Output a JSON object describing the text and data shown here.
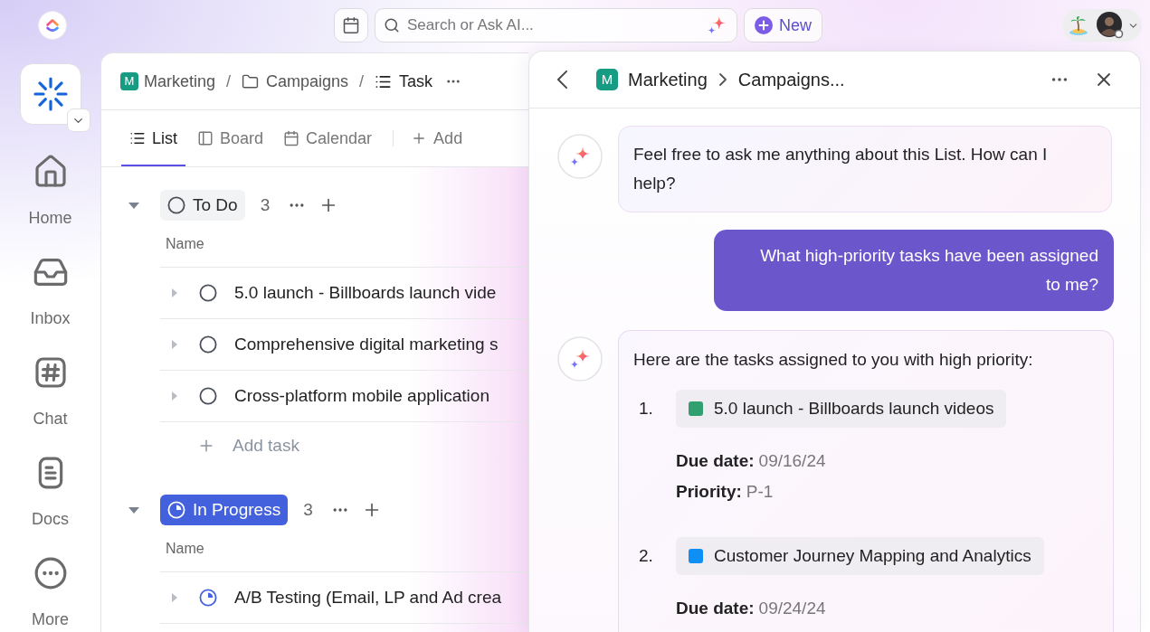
{
  "top_bar": {
    "search": {
      "placeholder": "Search or Ask AI..."
    },
    "new_button": "New"
  },
  "sidebar": {
    "items": [
      {
        "label": "Home",
        "selected": false
      },
      {
        "label": "Inbox",
        "selected": false
      },
      {
        "label": "Chat",
        "selected": false
      },
      {
        "label": "Docs",
        "selected": false
      },
      {
        "label": "More",
        "selected": false
      }
    ]
  },
  "list_view": {
    "breadcrumb": [
      {
        "kind": "space",
        "badge": "M",
        "label": "Marketing"
      },
      {
        "kind": "separator",
        "label": "/"
      },
      {
        "kind": "folder",
        "label": "Campaigns"
      },
      {
        "kind": "separator",
        "label": "/"
      },
      {
        "kind": "list",
        "label": "Task"
      }
    ],
    "tabs": [
      {
        "label": "List",
        "selected": true
      },
      {
        "label": "Board",
        "selected": false
      },
      {
        "label": "Calendar",
        "selected": false
      }
    ],
    "add_view": "Add",
    "groups": [
      {
        "kind": "todo",
        "status": "To Do",
        "count": "3",
        "expanded": true,
        "column_header": "Name",
        "tasks": [
          {
            "name": "5.0 launch - Billboards launch vide",
            "expanded": false
          },
          {
            "name": "Comprehensive digital marketing s",
            "expanded": false
          },
          {
            "name": "Cross-platform mobile application",
            "expanded": false
          }
        ],
        "add_task": "Add task"
      },
      {
        "kind": "in_progress",
        "status": "In Progress",
        "count": "3",
        "expanded": true,
        "column_header": "Name",
        "tasks": [
          {
            "name": "A/B Testing (Email, LP and Ad crea",
            "expanded": false
          }
        ]
      }
    ]
  },
  "chat_panel": {
    "breadcrumb": [
      {
        "badge": "M",
        "label": "Marketing"
      },
      {
        "label": "Campaigns..."
      }
    ],
    "messages": [
      {
        "kind": "assistant",
        "text": "Feel free to ask me anything about this List. How can I help?"
      },
      {
        "kind": "user",
        "text": "What high-priority tasks have been assigned to me?"
      },
      {
        "kind": "assistant",
        "text": "Here are the tasks assigned to you with high priority:",
        "tasks": [
          {
            "number": "1.",
            "name": "5.0 launch - Billboards launch videos",
            "color": "#32a06e",
            "fields": [
              {
                "label": "Due date:",
                "value": "09/16/24"
              },
              {
                "label": "Priority:",
                "value": "P-1"
              }
            ]
          },
          {
            "number": "2.",
            "name": "Customer Journey Mapping and Analytics",
            "color": "#0e8ff5",
            "fields": [
              {
                "label": "Due date:",
                "value": "09/24/24"
              }
            ]
          }
        ]
      }
    ]
  }
}
